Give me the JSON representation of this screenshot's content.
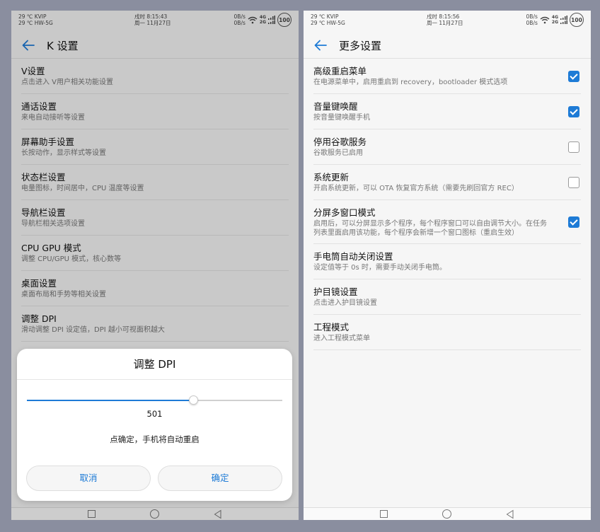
{
  "status_left_screen": {
    "line1": "29 ℃ KVIP",
    "line2": "29 ℃ HW-5G",
    "time": "戌时 8:15:43",
    "date": "周一 11月27日",
    "speed1": "0B/s",
    "speed2": "0B/s",
    "net1": "4G",
    "net2": "2G",
    "battery": "100"
  },
  "status_right_screen": {
    "line1": "29 ℃ KVIP",
    "line2": "29 ℃ HW-5G",
    "time": "戌时 8:15:56",
    "date": "周一 11月27日",
    "speed1": "0B/s",
    "speed2": "0B/s",
    "net1": "4G",
    "net2": "2G",
    "battery": "100"
  },
  "left_screen": {
    "title": "K 设置",
    "items": [
      {
        "title": "V设置",
        "subtitle": "点击进入 V用户相关功能设置"
      },
      {
        "title": "通话设置",
        "subtitle": "来电自动接听等设置"
      },
      {
        "title": "屏幕助手设置",
        "subtitle": "长按动作，显示样式等设置"
      },
      {
        "title": "状态栏设置",
        "subtitle": "电量图标，时间居中，CPU 温度等设置"
      },
      {
        "title": "导航栏设置",
        "subtitle": "导航栏相关选项设置"
      },
      {
        "title": "CPU GPU 模式",
        "subtitle": "调整 CPU/GPU 模式，核心数等"
      },
      {
        "title": "桌面设置",
        "subtitle": "桌面布局和手势等相关设置"
      },
      {
        "title": "调整 DPI",
        "subtitle": "滑动调整 DPI 设定值，DPI 越小可视面积越大"
      }
    ]
  },
  "dialog": {
    "title": "调整 DPI",
    "value": "501",
    "slider_fraction": 0.65,
    "message": "点确定，手机将自动重启",
    "cancel": "取消",
    "ok": "确定"
  },
  "right_screen": {
    "title": "更多设置",
    "items": [
      {
        "title": "高级重启菜单",
        "subtitle": "在电源菜单中，启用重启到 recovery，bootloader 模式选项",
        "checked": true
      },
      {
        "title": "音量键唤醒",
        "subtitle": "按音量键唤醒手机",
        "checked": true
      },
      {
        "title": "停用谷歌服务",
        "subtitle": "谷歌服务已启用",
        "checked": false
      },
      {
        "title": "系统更新",
        "subtitle": "开启系统更新，可以 OTA 恢复官方系统（需要先刷回官方 REC）",
        "checked": false
      },
      {
        "title": "分屏多窗口模式",
        "subtitle": "启用后，可以分屏显示多个程序，每个程序窗口可以自由调节大小。在任务列表里面启用该功能，每个程序会新增一个窗口图标（重启生效）",
        "checked": true
      },
      {
        "title": "手电筒自动关闭设置",
        "subtitle": "设定值等于 0s 时，需要手动关闭手电筒。"
      },
      {
        "title": "护目镜设置",
        "subtitle": "点击进入护目镜设置"
      },
      {
        "title": "工程模式",
        "subtitle": "进入工程模式菜单"
      }
    ]
  },
  "colors": {
    "accent": "#1e7bd6",
    "background": "#8a8e9f",
    "overlay": "rgba(0,0,0,0.18)"
  },
  "icons": [
    "back-arrow-icon",
    "wifi-icon",
    "signal-icon",
    "battery-icon",
    "nav-recents-icon",
    "nav-home-icon",
    "nav-back-icon",
    "checkbox-checked-icon",
    "checkbox-unchecked-icon"
  ]
}
